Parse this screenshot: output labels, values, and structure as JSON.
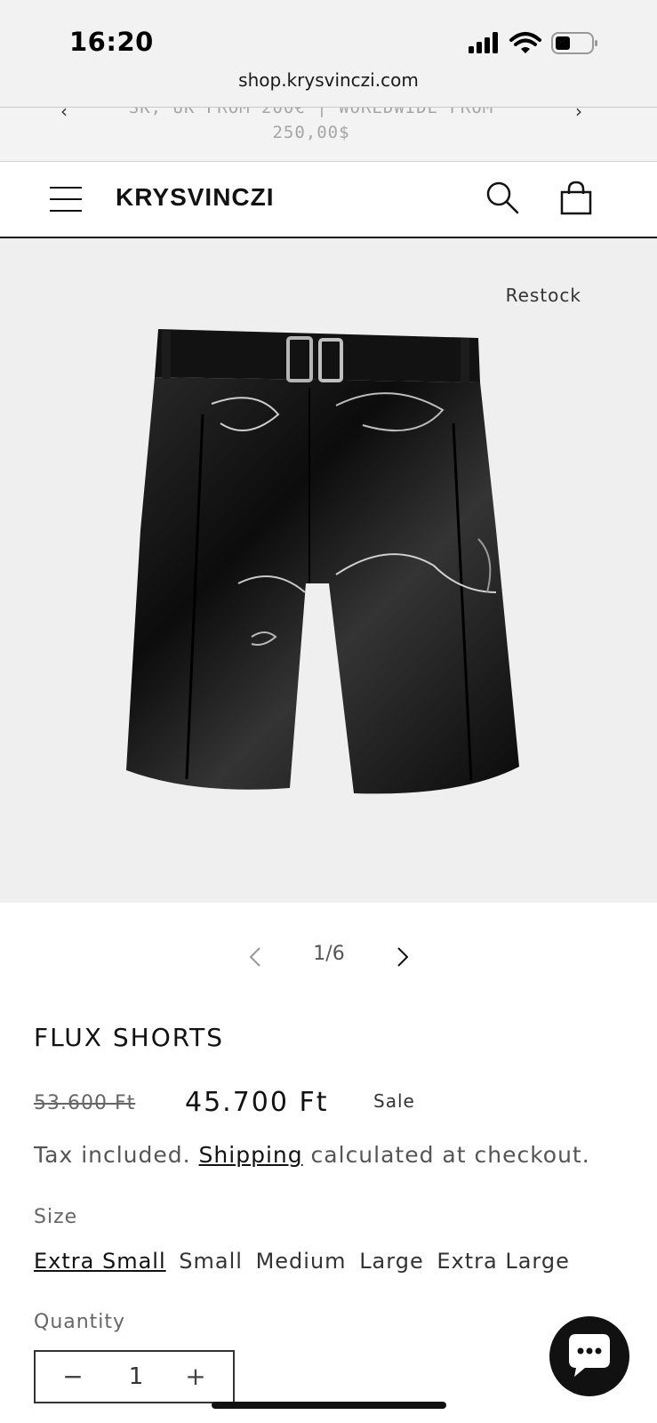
{
  "status_bar": {
    "time": "16:20",
    "url": "shop.krysvinczi.com",
    "icons": [
      "signal-icon",
      "wifi-icon",
      "battery-icon"
    ]
  },
  "announcement": {
    "line1": "SK, UK FROM 200€ | WORLDWIDE FROM",
    "line2": "250,00$"
  },
  "header": {
    "logo": "KRYSVINCZI",
    "icons": [
      "menu-icon",
      "search-icon",
      "cart-icon"
    ]
  },
  "media": {
    "badge": "Restock",
    "counter": "1/6"
  },
  "product": {
    "title": "FLUX SHORTS",
    "price_old": "53.600 Ft",
    "price_new": "45.700 Ft",
    "sale_label": "Sale",
    "tax_before": "Tax included. ",
    "tax_link": "Shipping",
    "tax_after": " calculated at checkout."
  },
  "size": {
    "label": "Size",
    "options": [
      "Extra Small",
      "Small",
      "Medium",
      "Large",
      "Extra Large"
    ],
    "selected": "Extra Small"
  },
  "quantity": {
    "label": "Quantity",
    "value": "1",
    "minus": "−",
    "plus": "+"
  },
  "colors": {
    "foreground": "#121212",
    "media_background": "#efefef",
    "chat_button": "#111111"
  }
}
